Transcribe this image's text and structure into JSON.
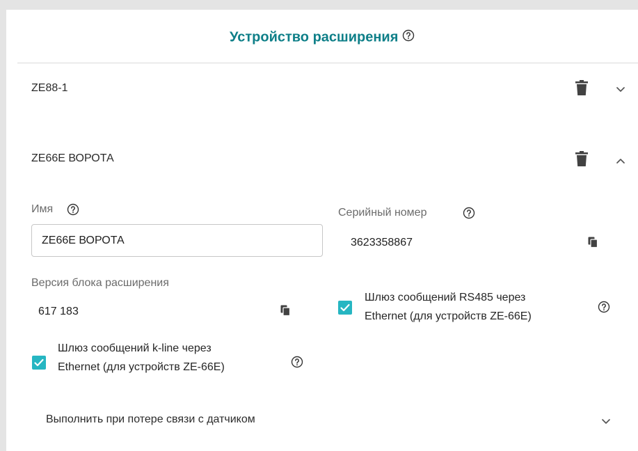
{
  "header": {
    "title": "Устройство расширения"
  },
  "devices": [
    {
      "name": "ZE88-1",
      "expanded": false
    },
    {
      "name": "ZE66E ВОРОТА",
      "expanded": true
    }
  ],
  "form": {
    "name_label": "Имя",
    "name_value": "ZE66E ВОРОТА",
    "serial_label": "Серийный номер",
    "serial_value": "3623358867",
    "version_label": "Версия блока расширения",
    "version_value": "617 183",
    "rs485_checkbox": {
      "line1": "Шлюз сообщений RS485 через",
      "line2": "Ethernet (для устройств ZE-66E)",
      "checked": true
    },
    "kline_checkbox": {
      "line1": "Шлюз сообщений k-line через",
      "line2": "Ethernet (для устройств ZE-66E)",
      "checked": true
    },
    "sensor_loss_section": "Выполнить при потере связи с датчиком"
  },
  "colors": {
    "accent": "#0e7f88",
    "checkbox": "#26b6c2",
    "icon": "#424242"
  },
  "icons": [
    "help-icon",
    "trash-icon",
    "chevron-down-icon",
    "chevron-up-icon",
    "copy-icon",
    "check-icon"
  ]
}
